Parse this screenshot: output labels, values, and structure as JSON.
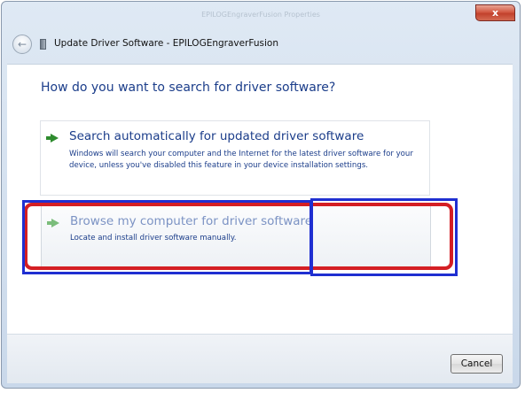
{
  "window": {
    "ghost_title": "EPILOGEngraverFusion Properties",
    "close_symbol": "x"
  },
  "header": {
    "title": "Update Driver Software - EPILOGEngraverFusion",
    "back_icon": "back-arrow-icon",
    "device_icon": "device-icon"
  },
  "main": {
    "question": "How do you want to search for driver software?",
    "options": [
      {
        "title": "Search automatically for updated driver software",
        "description": "Windows will search your computer and the Internet for the latest driver software for your device, unless you've disabled this feature in your device installation settings.",
        "icon": "green-arrow-icon"
      },
      {
        "title": "Browse my computer for driver software",
        "description": "Locate and install driver software manually.",
        "icon": "green-arrow-icon"
      }
    ]
  },
  "footer": {
    "cancel_label": "Cancel"
  },
  "colors": {
    "link_blue": "#1b3d8a",
    "arrow_green": "#2e8b2e",
    "highlight_red": "#d41f24",
    "highlight_blue": "#1f2fd1"
  }
}
